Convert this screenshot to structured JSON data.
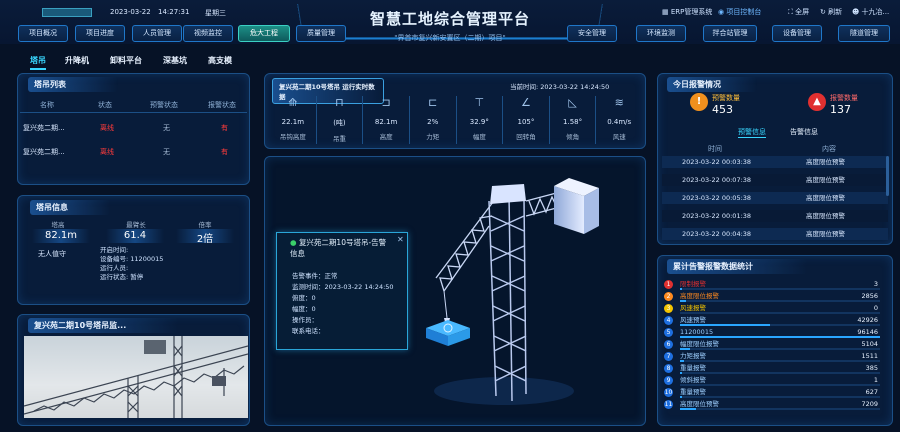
{
  "header": {
    "date": "2023-03-22",
    "time": "14:27:31",
    "weekday": "星期三",
    "title": "智慧工地综合管理平台",
    "subtitle": "\"界首市复兴新安置区（二期）项目\"",
    "erp": "ERP管理系统",
    "control": "项目控制台",
    "fullscreen": "全屏",
    "refresh": "刷新",
    "user": "十九冶..."
  },
  "nav_left": [
    "项目概况",
    "项目进度",
    "人员管理",
    "视频监控",
    "危大工程",
    "质量管理"
  ],
  "nav_right": [
    "安全管理",
    "环境监测",
    "拌合站管理",
    "设备管理",
    "隧道管理"
  ],
  "subtabs": [
    "塔吊",
    "升降机",
    "卸料平台",
    "深基坑",
    "高支模"
  ],
  "crane_list": {
    "title": "塔吊列表",
    "columns": [
      "名称",
      "状态",
      "预警状态",
      "报警状态"
    ],
    "rows": [
      {
        "name": "复兴苑二期...",
        "status": "离线",
        "warn": "无",
        "alarm": "有"
      },
      {
        "name": "复兴苑二期...",
        "status": "离线",
        "warn": "无",
        "alarm": "有"
      }
    ]
  },
  "crane_info": {
    "title": "塔吊信息",
    "labels": [
      "塔高",
      "最臂长",
      "倍率"
    ],
    "values": [
      "82.1m",
      "61.4",
      "2倍"
    ],
    "driver": "无人值守",
    "details": [
      {
        "k": "开启时间:",
        "v": ""
      },
      {
        "k": "设备编号:",
        "v": "11200015"
      },
      {
        "k": "运行人员:",
        "v": ""
      },
      {
        "k": "运行状态:",
        "v": "暂停"
      }
    ]
  },
  "video": {
    "title": "复兴苑二期10号塔吊监..."
  },
  "realtime": {
    "title": "复兴苑二期10号塔吊 运行实时数据",
    "time_label": "当前时间:",
    "time": "2023-03-22 14:24:50",
    "items": [
      {
        "icon": "⟰",
        "value": "22.1m",
        "label": "吊钩高度"
      },
      {
        "icon": "⊓",
        "value": "(吨)",
        "label": "吊重"
      },
      {
        "icon": "⊐",
        "value": "82.1m",
        "label": "高度"
      },
      {
        "icon": "⊏",
        "value": "2%",
        "label": "力矩"
      },
      {
        "icon": "⊤",
        "value": "32.9°",
        "label": "幅度"
      },
      {
        "icon": "∠",
        "value": "105°",
        "label": "回转角"
      },
      {
        "icon": "◺",
        "value": "1.58°",
        "label": "倾角"
      },
      {
        "icon": "≋",
        "value": "0.4m/s",
        "label": "风速"
      }
    ]
  },
  "popup": {
    "title": "复兴苑二期10号塔吊-告警信息",
    "lines": [
      "告警事件：正常",
      "监测时间：2023-03-22 14:24:50",
      "俯度：0",
      "幅度：0",
      "操作员：",
      "联系电话："
    ]
  },
  "today_alarm": {
    "title": "今日报警情况",
    "warn_label": "预警数量",
    "warn_count": "453",
    "alarm_label": "报警数量",
    "alarm_count": "137",
    "tabs": [
      "预警信息",
      "告警信息"
    ],
    "columns": [
      "时间",
      "内容"
    ],
    "rows": [
      {
        "time": "2023-03-22 00:03:38",
        "content": "高度限位预警"
      },
      {
        "time": "2023-03-22 00:07:38",
        "content": "高度限位预警"
      },
      {
        "time": "2023-03-22 00:05:38",
        "content": "高度限位预警"
      },
      {
        "time": "2023-03-22 00:01:38",
        "content": "高度限位预警"
      },
      {
        "time": "2023-03-22 00:04:38",
        "content": "高度限位预警"
      }
    ]
  },
  "stats": {
    "title": "累计告警报警数据统计",
    "rows": [
      {
        "rank": "1",
        "name": "限制报警",
        "value": "3",
        "fill": 0.01,
        "color": "#e03030"
      },
      {
        "rank": "2",
        "name": "高度限位报警",
        "value": "2856",
        "fill": 0.03,
        "color": "#ff8a1f"
      },
      {
        "rank": "3",
        "name": "风速报警",
        "value": "0",
        "fill": 0.0,
        "color": "#f2c300"
      },
      {
        "rank": "4",
        "name": "风速预警",
        "value": "42926",
        "fill": 0.45,
        "color": "#1e6fe0"
      },
      {
        "rank": "5",
        "name": "11200015",
        "value": "96146",
        "fill": 1.0,
        "color": "#1e6fe0"
      },
      {
        "rank": "6",
        "name": "幅度限位报警",
        "value": "5104",
        "fill": 0.05,
        "color": "#1e6fe0"
      },
      {
        "rank": "7",
        "name": "力矩报警",
        "value": "1511",
        "fill": 0.02,
        "color": "#1e6fe0"
      },
      {
        "rank": "8",
        "name": "重量报警",
        "value": "385",
        "fill": 0.01,
        "color": "#1e6fe0"
      },
      {
        "rank": "9",
        "name": "倾斜报警",
        "value": "1",
        "fill": 0.0,
        "color": "#1e6fe0"
      },
      {
        "rank": "10",
        "name": "重量预警",
        "value": "627",
        "fill": 0.01,
        "color": "#1e6fe0"
      },
      {
        "rank": "11",
        "name": "高度限位预警",
        "value": "7209",
        "fill": 0.08,
        "color": "#1e6fe0"
      }
    ]
  }
}
